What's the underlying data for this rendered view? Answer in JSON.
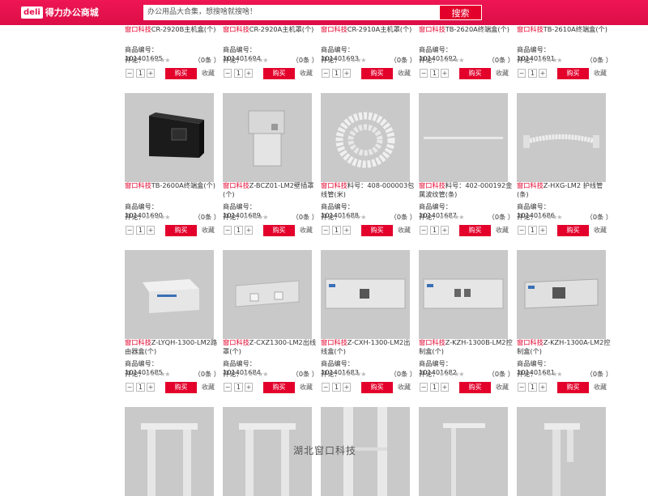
{
  "header": {
    "logo_mark": "deli",
    "logo_text": "得力办公商城",
    "search_placeholder": "办公用品大合集，想搜啥就搜啥！",
    "search_button": "搜索"
  },
  "labels": {
    "code_prefix": "商品编号：",
    "rating_prefix": "评论：",
    "stars": "★★★★★",
    "buy": "购买",
    "favorite": "收藏",
    "minus": "−",
    "plus": "+",
    "qty": "1"
  },
  "rows": [
    {
      "items": [
        {
          "brand": "窗口科技",
          "name": "CR-2920B主机盒(个)",
          "code": "101401695",
          "count": "（0条 ）"
        },
        {
          "brand": "窗口科技",
          "name": "CR-2920A主机罩(个)",
          "code": "101401694",
          "count": "（0条 ）"
        },
        {
          "brand": "窗口科技",
          "name": "CR-2910A主机罩(个)",
          "code": "101401693",
          "count": "（0条 ）"
        },
        {
          "brand": "窗口科技",
          "name": "TB-2620A终端盒(个)",
          "code": "101401692",
          "count": "（0条 ）"
        },
        {
          "brand": "窗口科技",
          "name": "TB-2610A终端盒(个)",
          "code": "101401691",
          "count": "（0条 ）"
        }
      ]
    },
    {
      "items": [
        {
          "brand": "窗口科技",
          "name": "TB-2600A终端盒(个)",
          "code": "101401690",
          "count": "（0条 ）",
          "img": "black-box"
        },
        {
          "brand": "窗口科技",
          "name": "Z-BCZ01-LM2壁插罩(个)",
          "code": "101401689",
          "count": "（0条 ）",
          "img": "wall-box"
        },
        {
          "brand": "窗口科技",
          "name": "料号：408-000003包线管(米)",
          "code": "101401688",
          "count": "（0条 ）",
          "img": "coil"
        },
        {
          "brand": "窗口科技",
          "name": "料号：402-000192金属波纹管(条)",
          "code": "101401687",
          "count": "（0条 ）",
          "img": "rod"
        },
        {
          "brand": "窗口科技",
          "name": "Z-HXG-LM2 护线管(条)",
          "code": "101401686",
          "count": "（0条 ）",
          "img": "flex-tube"
        }
      ]
    },
    {
      "items": [
        {
          "brand": "窗口科技",
          "name": "Z-LYQH-1300-LM2路由器盒(个)",
          "code": "101401685",
          "count": "（0条 ）",
          "img": "router-box"
        },
        {
          "brand": "窗口科技",
          "name": "Z-CXZ1300-LM2出线罩(个)",
          "code": "101401684",
          "count": "（0条 ）",
          "img": "outlet-cover"
        },
        {
          "brand": "窗口科技",
          "name": "Z-CXH-1300-LM2出线盒(个)",
          "code": "101401683",
          "count": "（0条 ）",
          "img": "long-panel"
        },
        {
          "brand": "窗口科技",
          "name": "Z-KZH-1300B-LM2控制盒(个)",
          "code": "101401682",
          "count": "（0条 ）",
          "img": "long-panel-2"
        },
        {
          "brand": "窗口科技",
          "name": "Z-KZH-1300A-LM2控制盒(个)",
          "code": "101401681",
          "count": "（0条 ）",
          "img": "control-box"
        }
      ]
    },
    {
      "items": [
        {
          "img": "frame-a"
        },
        {
          "img": "frame-b"
        },
        {
          "img": "frame-c"
        },
        {
          "img": "frame-d"
        },
        {
          "img": "frame-e"
        }
      ]
    }
  ],
  "watermark": "湖北窗口科技"
}
